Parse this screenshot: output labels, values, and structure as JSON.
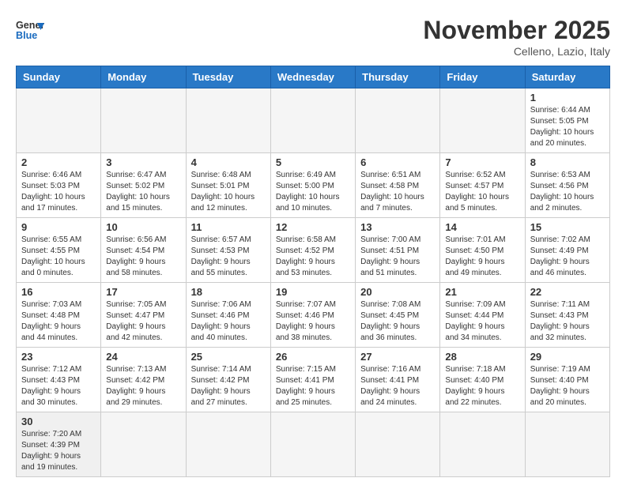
{
  "header": {
    "logo_general": "General",
    "logo_blue": "Blue",
    "title": "November 2025",
    "subtitle": "Celleno, Lazio, Italy"
  },
  "weekdays": [
    "Sunday",
    "Monday",
    "Tuesday",
    "Wednesday",
    "Thursday",
    "Friday",
    "Saturday"
  ],
  "weeks": [
    [
      {
        "day": "",
        "info": ""
      },
      {
        "day": "",
        "info": ""
      },
      {
        "day": "",
        "info": ""
      },
      {
        "day": "",
        "info": ""
      },
      {
        "day": "",
        "info": ""
      },
      {
        "day": "",
        "info": ""
      },
      {
        "day": "1",
        "info": "Sunrise: 6:44 AM\nSunset: 5:05 PM\nDaylight: 10 hours and 20 minutes."
      }
    ],
    [
      {
        "day": "2",
        "info": "Sunrise: 6:46 AM\nSunset: 5:03 PM\nDaylight: 10 hours and 17 minutes."
      },
      {
        "day": "3",
        "info": "Sunrise: 6:47 AM\nSunset: 5:02 PM\nDaylight: 10 hours and 15 minutes."
      },
      {
        "day": "4",
        "info": "Sunrise: 6:48 AM\nSunset: 5:01 PM\nDaylight: 10 hours and 12 minutes."
      },
      {
        "day": "5",
        "info": "Sunrise: 6:49 AM\nSunset: 5:00 PM\nDaylight: 10 hours and 10 minutes."
      },
      {
        "day": "6",
        "info": "Sunrise: 6:51 AM\nSunset: 4:58 PM\nDaylight: 10 hours and 7 minutes."
      },
      {
        "day": "7",
        "info": "Sunrise: 6:52 AM\nSunset: 4:57 PM\nDaylight: 10 hours and 5 minutes."
      },
      {
        "day": "8",
        "info": "Sunrise: 6:53 AM\nSunset: 4:56 PM\nDaylight: 10 hours and 2 minutes."
      }
    ],
    [
      {
        "day": "9",
        "info": "Sunrise: 6:55 AM\nSunset: 4:55 PM\nDaylight: 10 hours and 0 minutes."
      },
      {
        "day": "10",
        "info": "Sunrise: 6:56 AM\nSunset: 4:54 PM\nDaylight: 9 hours and 58 minutes."
      },
      {
        "day": "11",
        "info": "Sunrise: 6:57 AM\nSunset: 4:53 PM\nDaylight: 9 hours and 55 minutes."
      },
      {
        "day": "12",
        "info": "Sunrise: 6:58 AM\nSunset: 4:52 PM\nDaylight: 9 hours and 53 minutes."
      },
      {
        "day": "13",
        "info": "Sunrise: 7:00 AM\nSunset: 4:51 PM\nDaylight: 9 hours and 51 minutes."
      },
      {
        "day": "14",
        "info": "Sunrise: 7:01 AM\nSunset: 4:50 PM\nDaylight: 9 hours and 49 minutes."
      },
      {
        "day": "15",
        "info": "Sunrise: 7:02 AM\nSunset: 4:49 PM\nDaylight: 9 hours and 46 minutes."
      }
    ],
    [
      {
        "day": "16",
        "info": "Sunrise: 7:03 AM\nSunset: 4:48 PM\nDaylight: 9 hours and 44 minutes."
      },
      {
        "day": "17",
        "info": "Sunrise: 7:05 AM\nSunset: 4:47 PM\nDaylight: 9 hours and 42 minutes."
      },
      {
        "day": "18",
        "info": "Sunrise: 7:06 AM\nSunset: 4:46 PM\nDaylight: 9 hours and 40 minutes."
      },
      {
        "day": "19",
        "info": "Sunrise: 7:07 AM\nSunset: 4:46 PM\nDaylight: 9 hours and 38 minutes."
      },
      {
        "day": "20",
        "info": "Sunrise: 7:08 AM\nSunset: 4:45 PM\nDaylight: 9 hours and 36 minutes."
      },
      {
        "day": "21",
        "info": "Sunrise: 7:09 AM\nSunset: 4:44 PM\nDaylight: 9 hours and 34 minutes."
      },
      {
        "day": "22",
        "info": "Sunrise: 7:11 AM\nSunset: 4:43 PM\nDaylight: 9 hours and 32 minutes."
      }
    ],
    [
      {
        "day": "23",
        "info": "Sunrise: 7:12 AM\nSunset: 4:43 PM\nDaylight: 9 hours and 30 minutes."
      },
      {
        "day": "24",
        "info": "Sunrise: 7:13 AM\nSunset: 4:42 PM\nDaylight: 9 hours and 29 minutes."
      },
      {
        "day": "25",
        "info": "Sunrise: 7:14 AM\nSunset: 4:42 PM\nDaylight: 9 hours and 27 minutes."
      },
      {
        "day": "26",
        "info": "Sunrise: 7:15 AM\nSunset: 4:41 PM\nDaylight: 9 hours and 25 minutes."
      },
      {
        "day": "27",
        "info": "Sunrise: 7:16 AM\nSunset: 4:41 PM\nDaylight: 9 hours and 24 minutes."
      },
      {
        "day": "28",
        "info": "Sunrise: 7:18 AM\nSunset: 4:40 PM\nDaylight: 9 hours and 22 minutes."
      },
      {
        "day": "29",
        "info": "Sunrise: 7:19 AM\nSunset: 4:40 PM\nDaylight: 9 hours and 20 minutes."
      }
    ],
    [
      {
        "day": "30",
        "info": "Sunrise: 7:20 AM\nSunset: 4:39 PM\nDaylight: 9 hours and 19 minutes."
      },
      {
        "day": "",
        "info": ""
      },
      {
        "day": "",
        "info": ""
      },
      {
        "day": "",
        "info": ""
      },
      {
        "day": "",
        "info": ""
      },
      {
        "day": "",
        "info": ""
      },
      {
        "day": "",
        "info": ""
      }
    ]
  ]
}
